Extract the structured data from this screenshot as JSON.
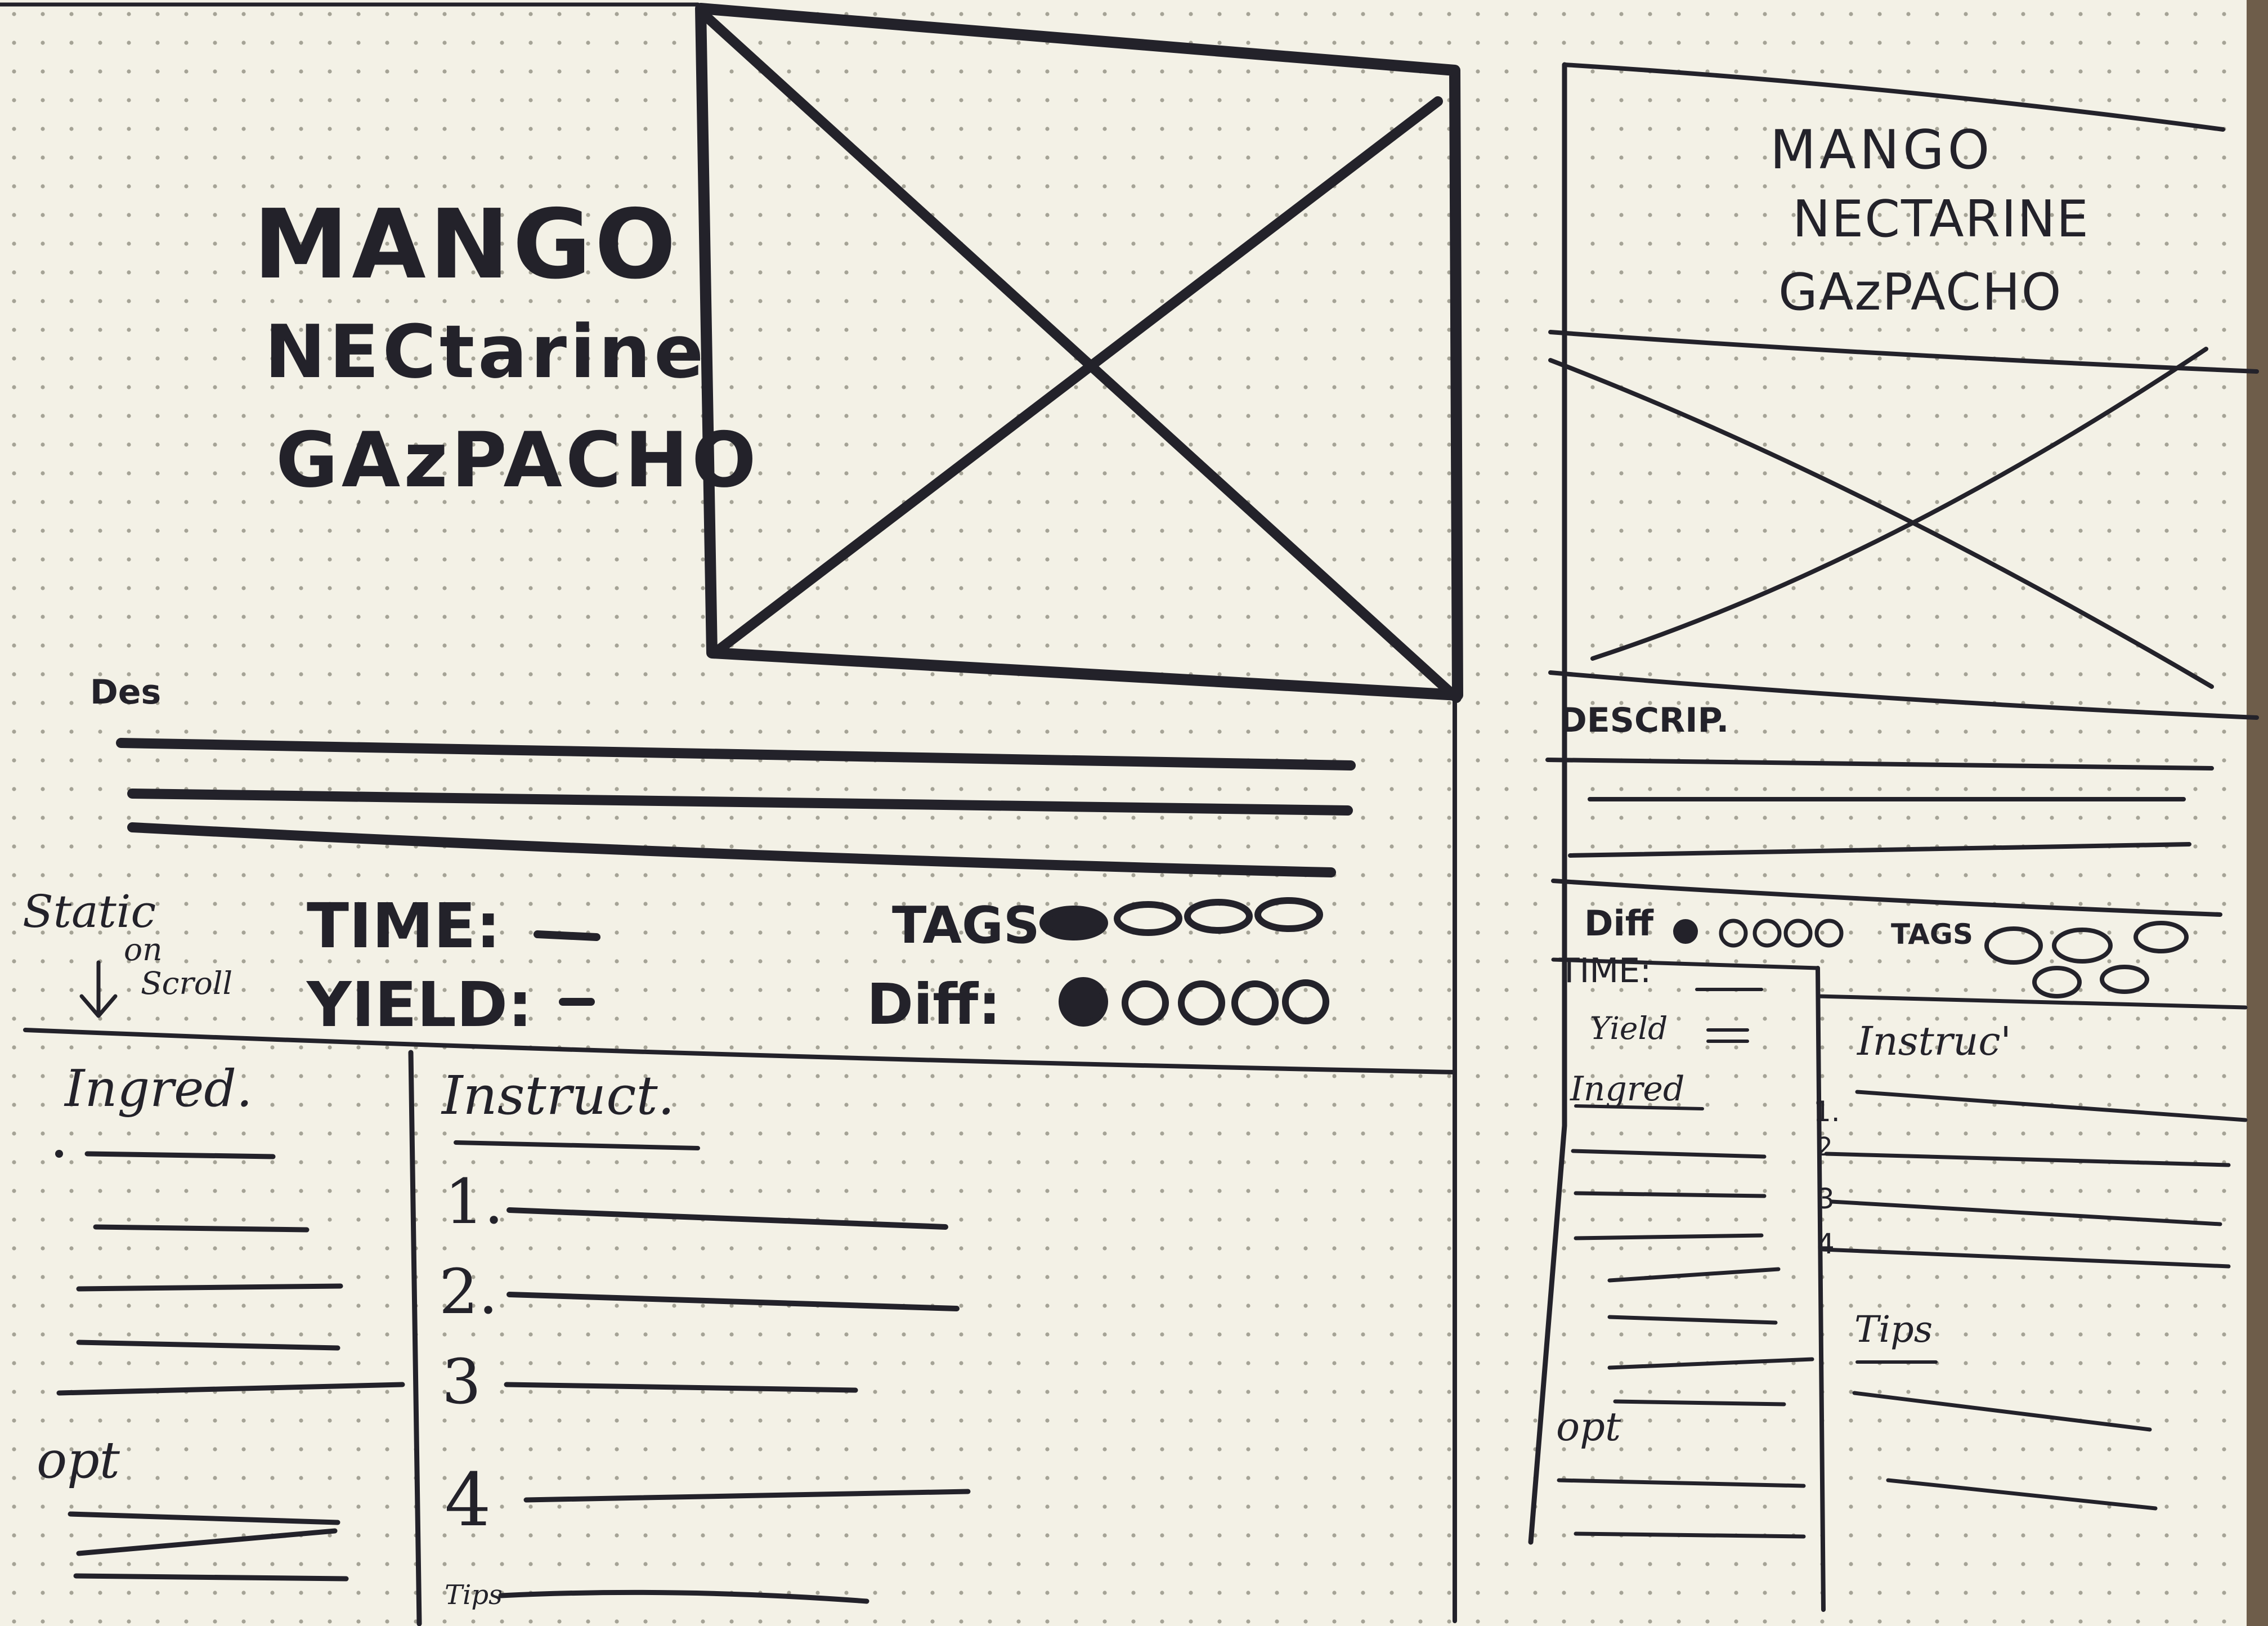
{
  "desktop": {
    "title": [
      "MANGO",
      "NECtarine",
      "GAzPACHO"
    ],
    "description_label": "Des",
    "static_note": {
      "line1": "Static",
      "line2": "on",
      "line3": "Scroll"
    },
    "time_label": "TIME:",
    "yield_label": "YIELD:",
    "tags_label": "TAGS",
    "diff_label": "Diff:",
    "ingredients_label": "Ingred.",
    "instructions_label": "Instruct.",
    "instruction_numbers": [
      "1.",
      "2.",
      "3",
      "4"
    ],
    "optional_label": "opt",
    "tips_label": "Tips"
  },
  "mobile": {
    "title": [
      "MANGO",
      "NECTARINE",
      "GAzPACHO"
    ],
    "description_label": "DESCRIP.",
    "diff_label": "Diff",
    "tags_label": "TAGS",
    "time_label": "TIME:",
    "yield_label": "Yield",
    "ingredients_label": "Ingred",
    "instructions_label": "Instruc'",
    "instruction_numbers": [
      "1.",
      "2",
      "3",
      "4"
    ],
    "tips_label": "Tips",
    "optional_label": "opt"
  },
  "colors": {
    "paper": "#f3f1e6",
    "ink": "#23222a",
    "dot": "#9a988c",
    "edge": "#6b5a48"
  }
}
